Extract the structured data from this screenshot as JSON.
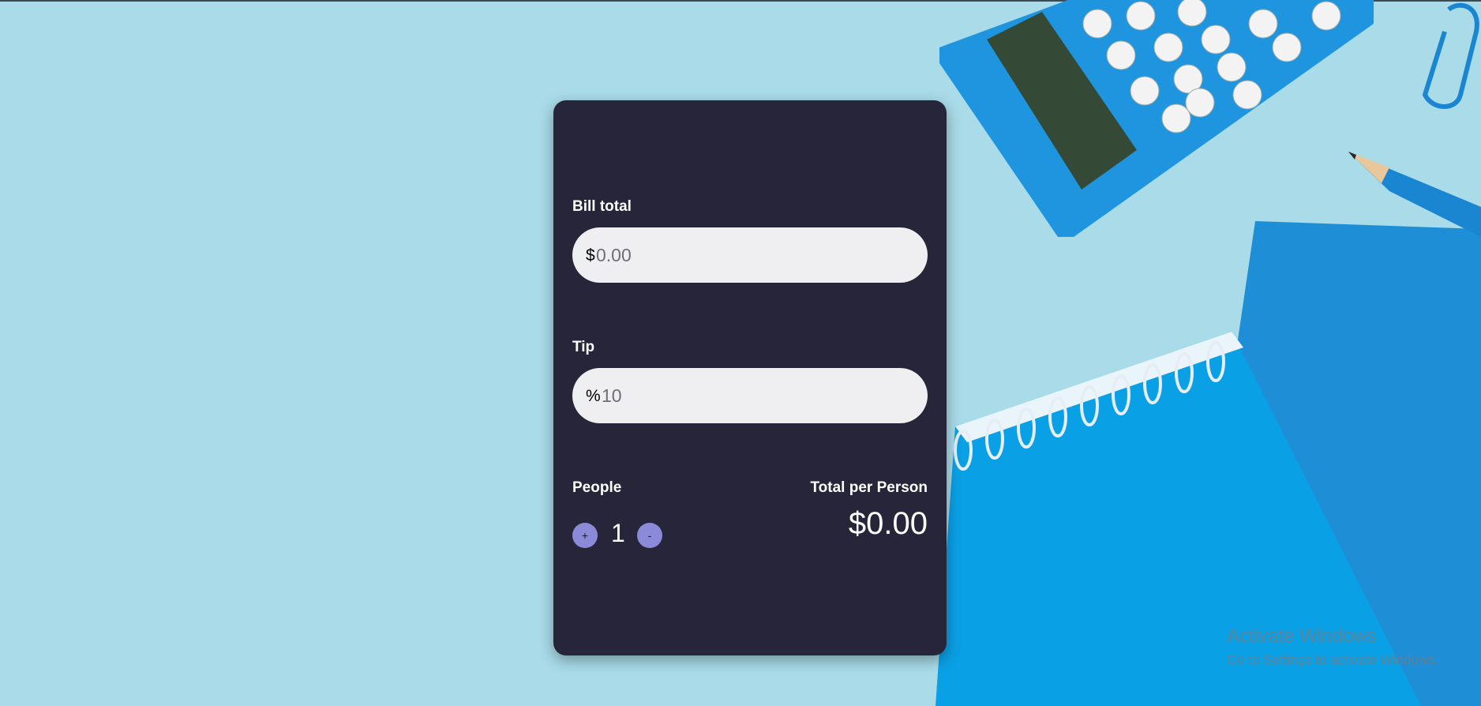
{
  "bill": {
    "label": "Bill total",
    "prefix": "$",
    "placeholder": "0.00"
  },
  "tip": {
    "label": "Tip",
    "prefix": "%",
    "placeholder": "10"
  },
  "people": {
    "label": "People",
    "increment": "+",
    "count": "1",
    "decrement": "-"
  },
  "total": {
    "label": "Total per Person",
    "value": "$0.00"
  },
  "watermark": {
    "title": "Activate Windows",
    "subtitle": "Go to Settings to activate Windows."
  },
  "colors": {
    "card": "#262539",
    "input": "#efeef1",
    "stepper": "#8a8ad8",
    "background": "#a9dbe9",
    "accent_blue": "#1f95e0"
  },
  "icons": [
    "calculator-icon",
    "pencil-icon",
    "paperclip-icon",
    "notebook-icon"
  ]
}
